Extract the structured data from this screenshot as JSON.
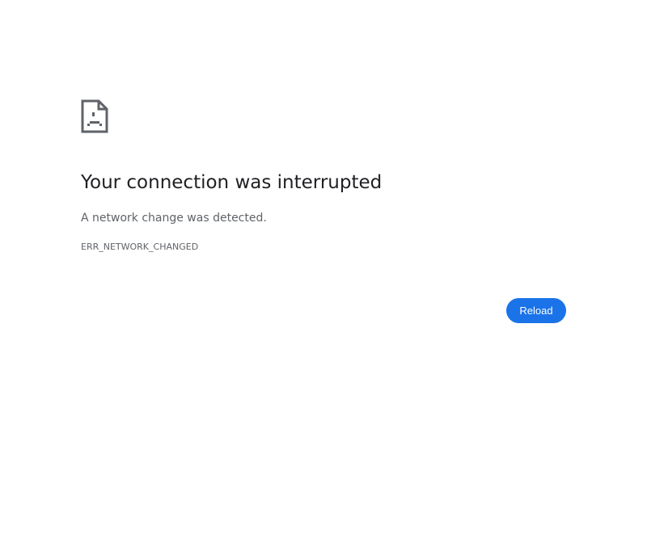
{
  "page": {
    "icon": "broken-document-icon",
    "title": "Your connection was interrupted",
    "message": "A network change was detected.",
    "error_code": "ERR_NETWORK_CHANGED"
  },
  "actions": {
    "reload_label": "Reload"
  },
  "colors": {
    "title": "#202124",
    "text": "#5f6368",
    "button_background": "#1a73e8",
    "button_text": "#ffffff",
    "icon": "#5f6368"
  }
}
